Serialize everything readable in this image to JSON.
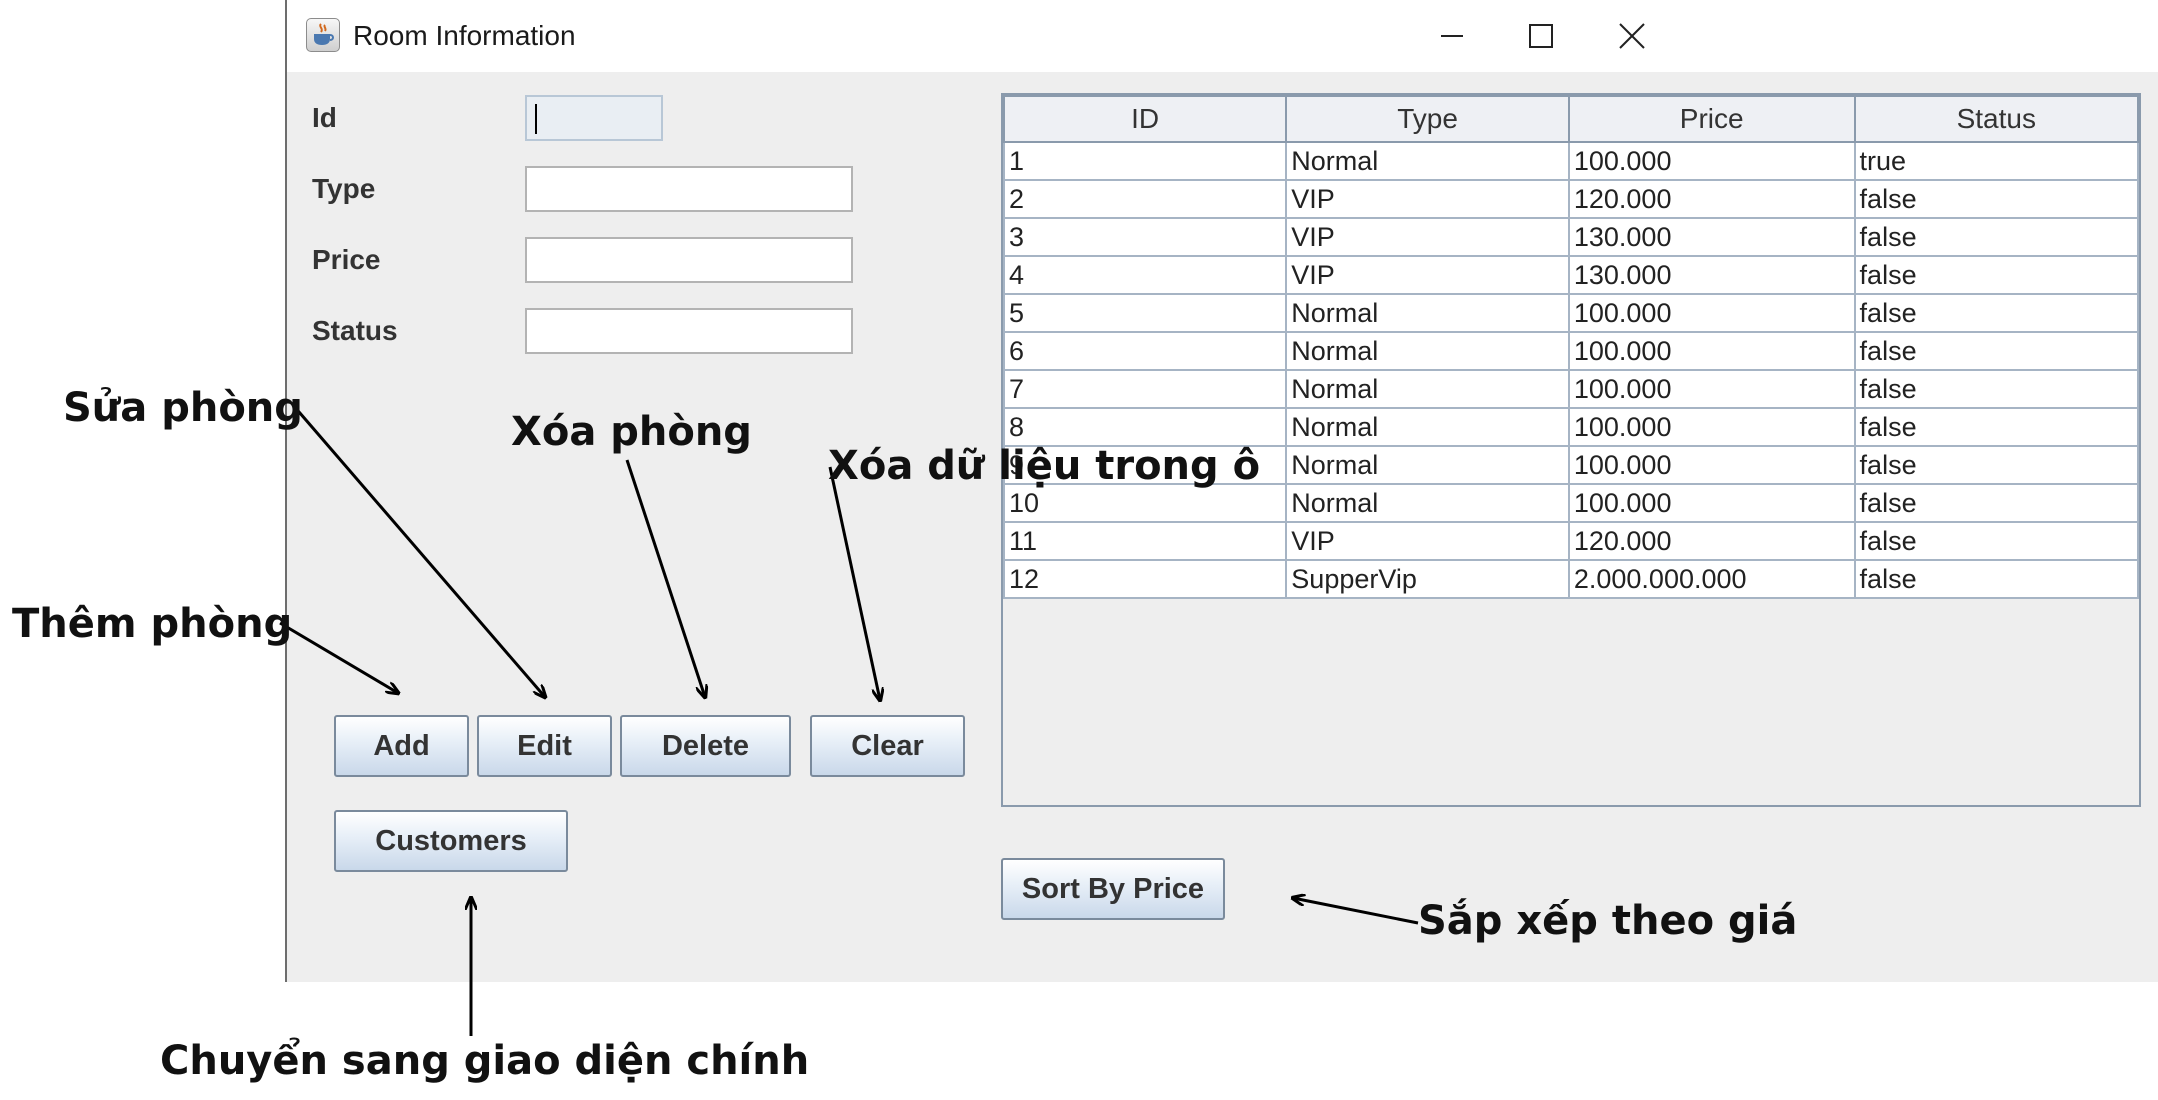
{
  "window": {
    "title": "Room Information"
  },
  "form": {
    "id_label": "Id",
    "type_label": "Type",
    "price_label": "Price",
    "status_label": "Status",
    "id_value": "",
    "type_value": "",
    "price_value": "",
    "status_value": ""
  },
  "buttons": {
    "add": "Add",
    "edit": "Edit",
    "delete": "Delete",
    "clear": "Clear",
    "customers": "Customers",
    "sort": "Sort By Price"
  },
  "table": {
    "columns": [
      "ID",
      "Type",
      "Price",
      "Status"
    ],
    "rows": [
      [
        "1",
        "Normal",
        "100.000",
        "true"
      ],
      [
        "2",
        "VIP",
        "120.000",
        "false"
      ],
      [
        "3",
        "VIP",
        "130.000",
        "false"
      ],
      [
        "4",
        "VIP",
        "130.000",
        "false"
      ],
      [
        "5",
        "Normal",
        "100.000",
        "false"
      ],
      [
        "6",
        "Normal",
        "100.000",
        "false"
      ],
      [
        "7",
        "Normal",
        "100.000",
        "false"
      ],
      [
        "8",
        "Normal",
        "100.000",
        "false"
      ],
      [
        "9",
        "Normal",
        "100.000",
        "false"
      ],
      [
        "10",
        "Normal",
        "100.000",
        "false"
      ],
      [
        "11",
        "VIP",
        "120.000",
        "false"
      ],
      [
        "12",
        "SupperVip",
        "2.000.000.000",
        "false"
      ]
    ]
  },
  "annotations": {
    "sua_phong": "Sửa phòng",
    "xoa_phong": "Xóa phòng",
    "xoa_du_lieu": "Xóa dữ liệu trong ô",
    "them_phong": "Thêm phòng",
    "chuyen_sang": "Chuyển sang  giao diện chính",
    "sap_xep": "Sắp xếp theo giá"
  },
  "icons": {
    "app": "java-cup-icon",
    "minimize": "minimize-icon",
    "maximize": "maximize-icon",
    "close": "close-icon"
  }
}
